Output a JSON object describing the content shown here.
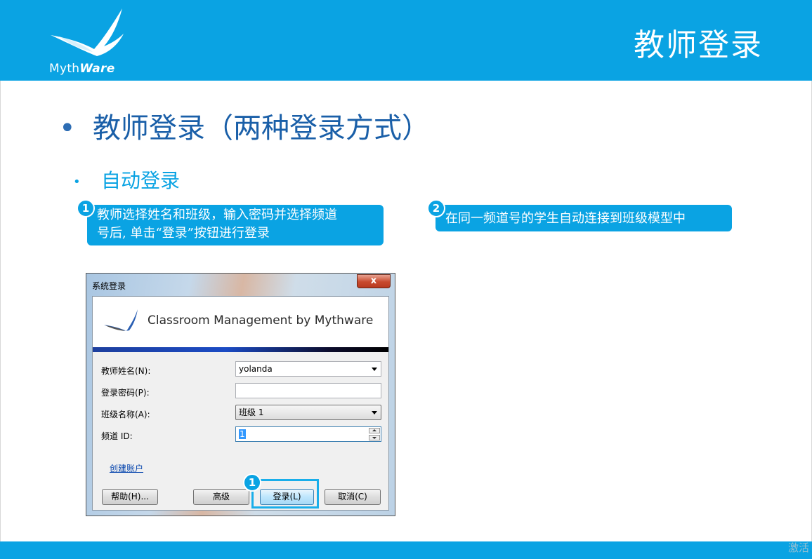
{
  "header": {
    "brand_prefix": "Myth",
    "brand_suffix": "Ware",
    "title": "教师登录"
  },
  "content": {
    "heading": "教师登录（两种登录方式）",
    "subheading": "自动登录",
    "callout1": {
      "number": "1",
      "line1": "教师选择姓名和班级，输入密码并选择频道",
      "line2": "号后, 单击“登录”按钮进行登录"
    },
    "callout2": {
      "number": "2",
      "text": "在同一频道号的学生自动连接到班级模型中"
    },
    "marker3": "1"
  },
  "dialog": {
    "title": "系统登录",
    "close_label": "x",
    "banner_text": "Classroom Management by Mythware",
    "teacher_label": "教师姓名(N):",
    "teacher_value": "yolanda",
    "password_label": "登录密码(P):",
    "password_value": "",
    "class_label": "班级名称(A):",
    "class_value": "班级 1",
    "channel_label": "频道 ID:",
    "channel_value": "1",
    "create_account_link": "创建账户",
    "help_button": "帮助(H)...",
    "advanced_button": "高级",
    "login_button": "登录(L)",
    "cancel_button": "取消(C)"
  },
  "footer": {
    "watermark": "激活"
  },
  "colors": {
    "accent": "#0aa3e3",
    "heading": "#1a5fa8"
  }
}
